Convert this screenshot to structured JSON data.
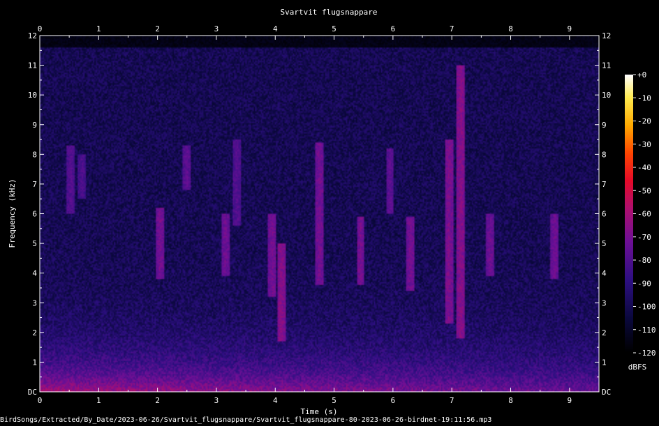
{
  "chart_data": {
    "type": "heatmap",
    "title": "Svartvit flugsnappare",
    "xlabel": "Time (s)",
    "ylabel": "Frequency (kHz)",
    "xlim": [
      0,
      9.5
    ],
    "ylim": [
      0,
      12
    ],
    "x_ticks": [
      "0",
      "1",
      "2",
      "3",
      "4",
      "5",
      "6",
      "7",
      "8",
      "9"
    ],
    "y_ticks": [
      "DC",
      "1",
      "2",
      "3",
      "4",
      "5",
      "6",
      "7",
      "8",
      "9",
      "10",
      "11",
      "12"
    ],
    "colorbar": {
      "label": "dBFS",
      "range": [
        -120,
        0
      ],
      "ticks": [
        "+0",
        "-10",
        "-20",
        "-30",
        "-40",
        "-50",
        "-60",
        "-70",
        "-80",
        "-90",
        "-100",
        "-110",
        "-120"
      ]
    },
    "signal_cutoff_khz": 11.6,
    "calls": [
      {
        "t": 0.52,
        "f_low": 6.0,
        "f_high": 8.3,
        "db": -78
      },
      {
        "t": 0.72,
        "f_low": 6.5,
        "f_high": 8.0,
        "db": -80
      },
      {
        "t": 2.05,
        "f_low": 3.8,
        "f_high": 6.2,
        "db": -70
      },
      {
        "t": 2.5,
        "f_low": 6.8,
        "f_high": 8.3,
        "db": -76
      },
      {
        "t": 3.15,
        "f_low": 3.9,
        "f_high": 6.0,
        "db": -72
      },
      {
        "t": 3.35,
        "f_low": 5.6,
        "f_high": 8.5,
        "db": -78
      },
      {
        "t": 3.95,
        "f_low": 3.2,
        "f_high": 6.0,
        "db": -70
      },
      {
        "t": 4.1,
        "f_low": 1.7,
        "f_high": 5.0,
        "db": -66
      },
      {
        "t": 4.75,
        "f_low": 3.6,
        "f_high": 8.4,
        "db": -70
      },
      {
        "t": 5.45,
        "f_low": 3.6,
        "f_high": 5.9,
        "db": -70
      },
      {
        "t": 5.95,
        "f_low": 6.0,
        "f_high": 8.2,
        "db": -76
      },
      {
        "t": 6.3,
        "f_low": 3.4,
        "f_high": 5.9,
        "db": -70
      },
      {
        "t": 6.95,
        "f_low": 2.3,
        "f_high": 8.5,
        "db": -68
      },
      {
        "t": 7.15,
        "f_low": 1.8,
        "f_high": 11.0,
        "db": -66
      },
      {
        "t": 7.65,
        "f_low": 3.9,
        "f_high": 6.0,
        "db": -72
      },
      {
        "t": 8.75,
        "f_low": 3.8,
        "f_high": 6.0,
        "db": -72
      }
    ]
  },
  "footer": {
    "filename": "BirdSongs/Extracted/By_Date/2023-06-26/Svartvit_flugsnappare/Svartvit_flugsnappare-80-2023-06-26-birdnet-19:11:56.mp3"
  }
}
